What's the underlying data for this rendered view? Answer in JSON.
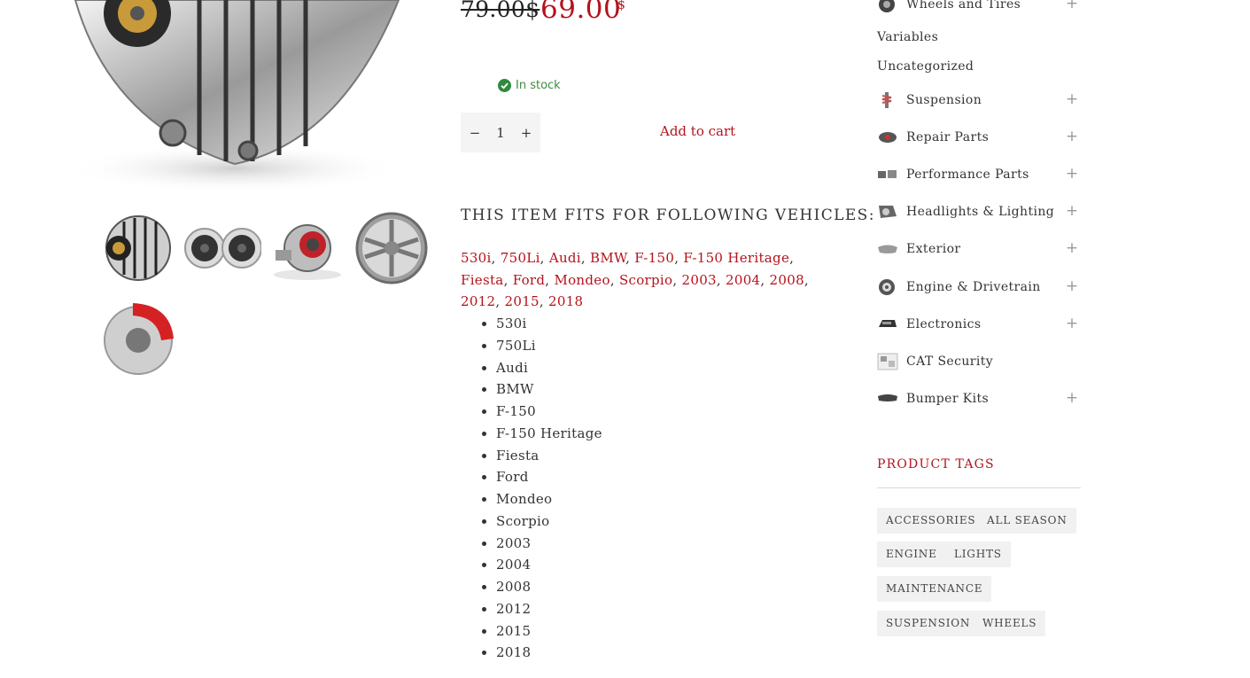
{
  "price": {
    "old": "79.00$",
    "new": "69.00",
    "currency": "$"
  },
  "stock": {
    "text": "In stock",
    "status_color": "#3e8c3e"
  },
  "cart": {
    "qty_minus": "−",
    "qty_plus": "+",
    "qty_value": "1",
    "add_label": "Add to cart"
  },
  "gallery": {
    "main_image": "alternator-image",
    "thumbnails": [
      "alternator",
      "speakers",
      "turbocharger",
      "wheel-rim",
      "brake-caliper"
    ]
  },
  "fits": {
    "heading": "THIS ITEM FITS FOR FOLLOWING VEHICLES:",
    "links": [
      "530i",
      "750Li",
      "Audi",
      "BMW",
      "F-150",
      "F-150 Heritage",
      "Fiesta",
      "Ford",
      "Mondeo",
      "Scorpio",
      "2003",
      "2004",
      "2008",
      "2012",
      "2015",
      "2018"
    ],
    "list": [
      "530i",
      "750Li",
      "Audi",
      "BMW",
      "F-150",
      "F-150 Heritage",
      "Fiesta",
      "Ford",
      "Mondeo",
      "Scorpio",
      "2003",
      "2004",
      "2008",
      "2012",
      "2015",
      "2018"
    ]
  },
  "sidebar": {
    "top_category": {
      "label": "Wheels and Tires",
      "icon": "tire-icon"
    },
    "plain_categories": [
      "Variables",
      "Uncategorized"
    ],
    "categories": [
      {
        "label": "Suspension",
        "icon": "shock-absorber-icon",
        "expandable": true
      },
      {
        "label": "Repair Parts",
        "icon": "repair-parts-icon",
        "expandable": true
      },
      {
        "label": "Performance Parts",
        "icon": "performance-parts-icon",
        "expandable": true
      },
      {
        "label": "Headlights & Lighting",
        "icon": "headlight-icon",
        "expandable": true
      },
      {
        "label": "Exterior",
        "icon": "exterior-icon",
        "expandable": true
      },
      {
        "label": "Engine & Drivetrain",
        "icon": "engine-icon",
        "expandable": true
      },
      {
        "label": "Electronics",
        "icon": "electronics-icon",
        "expandable": true
      },
      {
        "label": "CAT Security",
        "icon": "security-icon",
        "expandable": false
      },
      {
        "label": "Bumper Kits",
        "icon": "bumper-icon",
        "expandable": true
      }
    ],
    "plus_symbol": "+"
  },
  "tags": {
    "title": "PRODUCT TAGS",
    "items": [
      "ACCESSORIES",
      "ALL SEASON",
      "ENGINE",
      "LIGHTS",
      "MAINTENANCE",
      "SUSPENSION",
      "WHEELS"
    ]
  },
  "colors": {
    "accent": "#b5121b",
    "text": "#333333",
    "tag_bg": "#f1f1f1"
  }
}
